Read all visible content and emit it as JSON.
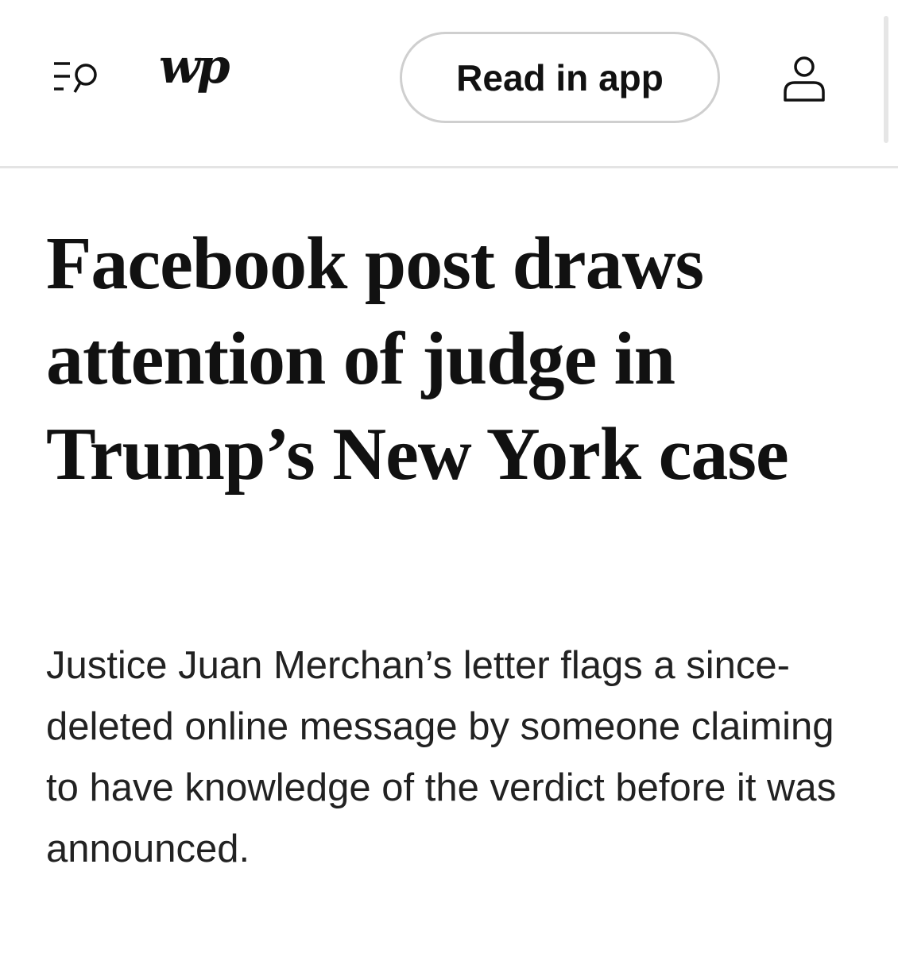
{
  "header": {
    "menu_search_icon": "menu-search-icon",
    "logo_text": "wp",
    "read_in_app_label": "Read in app",
    "user_icon": "user-account-icon"
  },
  "article": {
    "headline": "Facebook post draws attention of judge in Trump’s New York case",
    "dek": "Justice Juan Merchan’s letter flags a since-deleted online message by someone claiming to have knowledge of the verdict before it was announced."
  }
}
